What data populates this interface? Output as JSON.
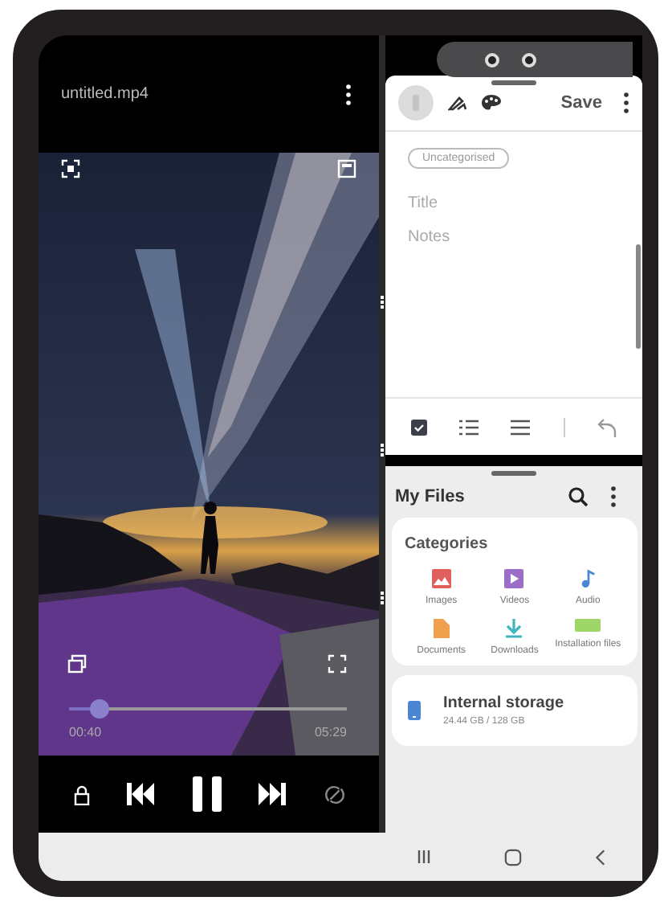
{
  "video": {
    "title": "untitled.mp4",
    "elapsed": "00:40",
    "total": "05:29",
    "progress": {
      "level": 0.11
    },
    "playing": true
  },
  "notes": {
    "action": "Save",
    "category": "Uncategorised",
    "title_placeholder": "Title",
    "body_placeholder": "Notes"
  },
  "files": {
    "title": "My Files",
    "section": "Categories",
    "categories": [
      {
        "label": "Images",
        "kind": "images",
        "color": "#e0605e"
      },
      {
        "label": "Videos",
        "kind": "videos",
        "color": "#9b6fc7"
      },
      {
        "label": "Audio",
        "kind": "audio",
        "color": "#4a86d4"
      },
      {
        "label": "Documents",
        "kind": "documents",
        "color": "#f0a14e"
      },
      {
        "label": "Downloads",
        "kind": "downloads",
        "color": "#3fb5bf"
      },
      {
        "label": "Installation files",
        "kind": "apk",
        "color": "#9ed66a"
      }
    ],
    "storage": {
      "label": "Internal storage",
      "usage": "24.44 GB / 128 GB"
    }
  }
}
